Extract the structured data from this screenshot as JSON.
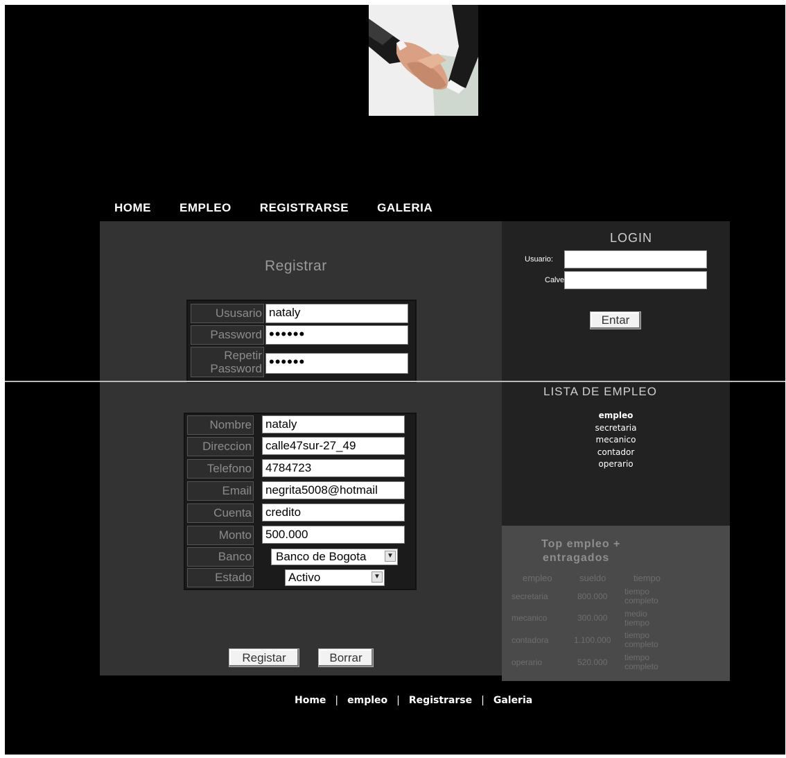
{
  "nav": {
    "home": "HOME",
    "empleo": "EMPLEO",
    "registrarse": "REGISTRARSE",
    "galeria": "GALERIA"
  },
  "register": {
    "title": "Registrar",
    "account_fields": [
      {
        "label": "Ususario",
        "value": "nataly"
      },
      {
        "label": "Password",
        "value": "••••••"
      },
      {
        "label": "Repetir Password",
        "label_line1": "Repetir",
        "label_line2": "Password",
        "value": "••••••"
      }
    ],
    "personal_fields": [
      {
        "label": "Nombre",
        "value": "nataly"
      },
      {
        "label": "Direccion",
        "value": "calle47sur-27_49"
      },
      {
        "label": "Telefono",
        "value": "4784723"
      },
      {
        "label": "Email",
        "value": "negrita5008@hotmail"
      },
      {
        "label": "Cuenta",
        "value": "credito"
      },
      {
        "label": "Monto",
        "value": "500.000"
      }
    ],
    "banco": {
      "label": "Banco",
      "selected": "Banco de Bogota"
    },
    "estado": {
      "label": "Estado",
      "selected": "Activo"
    },
    "submit_label": "Regista",
    "submit_label_rest": "r",
    "reset_label": "Borrar"
  },
  "login": {
    "title": "LOGIN",
    "user_label": "Usuario:",
    "pass_label": "Calve:",
    "button_label": "Entar"
  },
  "empleo_list": {
    "title": "LISTA DE EMPLEO",
    "header": "empleo",
    "items": [
      "secretaria",
      "mecanico",
      "contador",
      "operario"
    ]
  },
  "top_empleo": {
    "title_line1": "Top empleo +",
    "title_line2": "entragados",
    "headers": [
      "empleo",
      "sueldo",
      "tiempo"
    ],
    "rows": [
      {
        "empleo": "secretaria",
        "sueldo": "800.000",
        "tiempo1": "tiempo",
        "tiempo2": "completo"
      },
      {
        "empleo": "mecanico",
        "sueldo": "300.000",
        "tiempo1": "medio",
        "tiempo2": "tiempo"
      },
      {
        "empleo": "contadora",
        "sueldo": "1.100.000",
        "tiempo1": "tiempo",
        "tiempo2": "completo"
      },
      {
        "empleo": "operario",
        "sueldo": "520.000",
        "tiempo1": "tiempo",
        "tiempo2": "completo"
      }
    ]
  },
  "footer": {
    "home": "Home",
    "empleo": "empleo",
    "registrarse": "Registrarse",
    "galeria": "Galeria",
    "separator": "|"
  },
  "colors": {
    "background": "#000000",
    "main_panel": "#333333",
    "side_panel": "#222222",
    "top_panel": "#4a4a4a"
  }
}
